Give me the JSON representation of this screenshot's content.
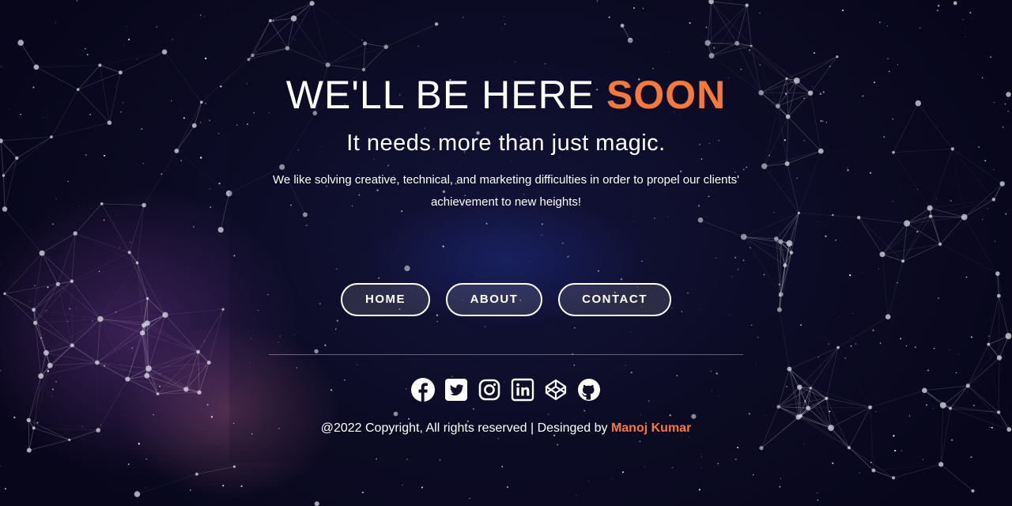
{
  "theme": {
    "accent": "#f6793b",
    "text": "#ffffff",
    "background": "#0b0a1e"
  },
  "hero": {
    "title_main": "WE'LL BE HERE ",
    "title_accent": "SOON",
    "tagline": "It needs more than just magic.",
    "description": "We like solving creative, technical, and marketing difficulties in order to propel our clients' achievement to new heights!"
  },
  "nav": {
    "home": "HOME",
    "about": "ABOUT",
    "contact": "CONTACT"
  },
  "social_icons": [
    "facebook-icon",
    "twitter-icon",
    "instagram-icon",
    "linkedin-icon",
    "codepen-icon",
    "github-icon"
  ],
  "footer": {
    "copyright": "@2022 Copyright, All rights reserved | Desinged by ",
    "author": "Manoj Kumar"
  }
}
